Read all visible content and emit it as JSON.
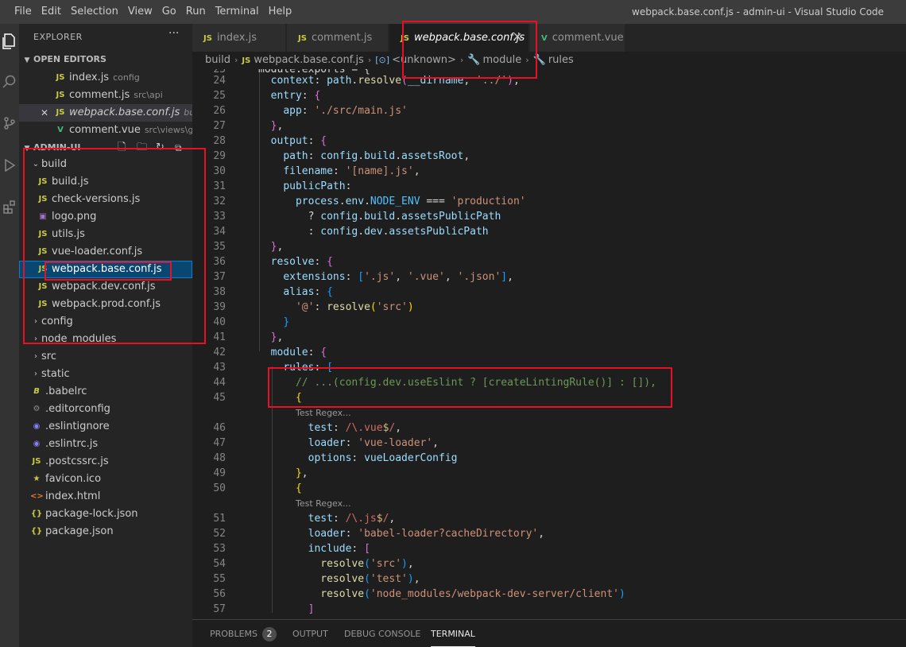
{
  "menu": [
    "File",
    "Edit",
    "Selection",
    "View",
    "Go",
    "Run",
    "Terminal",
    "Help"
  ],
  "window_title": "webpack.base.conf.js - admin-ui - Visual Studio Code",
  "sidebar": {
    "title": "EXPLORER",
    "more": "···",
    "open_editors": {
      "header": "OPEN EDITORS",
      "items": [
        {
          "icon": "JS",
          "name": "index.js",
          "desc": "config"
        },
        {
          "icon": "JS",
          "name": "comment.js",
          "desc": "src\\api"
        },
        {
          "icon": "JS",
          "name": "webpack.base.conf.js",
          "desc": "build"
        },
        {
          "icon": "V",
          "name": "comment.vue",
          "desc": "src\\views\\g..."
        }
      ]
    },
    "project": {
      "header": "ADMIN-UI",
      "tree": [
        {
          "type": "folder",
          "name": "build",
          "open": true
        },
        {
          "type": "file",
          "icon": "JS",
          "name": "build.js"
        },
        {
          "type": "file",
          "icon": "JS",
          "name": "check-versions.js"
        },
        {
          "type": "file",
          "icon": "IMG",
          "name": "logo.png"
        },
        {
          "type": "file",
          "icon": "JS",
          "name": "utils.js"
        },
        {
          "type": "file",
          "icon": "JS",
          "name": "vue-loader.conf.js"
        },
        {
          "type": "file",
          "icon": "JS",
          "name": "webpack.base.conf.js"
        },
        {
          "type": "file",
          "icon": "JS",
          "name": "webpack.dev.conf.js"
        },
        {
          "type": "file",
          "icon": "JS",
          "name": "webpack.prod.conf.js"
        },
        {
          "type": "folder",
          "name": "config"
        },
        {
          "type": "folder",
          "name": "node_modules"
        },
        {
          "type": "folder",
          "name": "src"
        },
        {
          "type": "folder",
          "name": "static"
        },
        {
          "type": "file",
          "icon": "B",
          "name": ".babelrc"
        },
        {
          "type": "file",
          "icon": "⚙",
          "name": ".editorconfig"
        },
        {
          "type": "file",
          "icon": "◉",
          "name": ".eslintignore"
        },
        {
          "type": "file",
          "icon": "◉",
          "name": ".eslintrc.js"
        },
        {
          "type": "file",
          "icon": "JS",
          "name": ".postcssrc.js"
        },
        {
          "type": "file",
          "icon": "★",
          "name": "favicon.ico"
        },
        {
          "type": "file",
          "icon": "<>",
          "name": "index.html"
        },
        {
          "type": "file",
          "icon": "{}",
          "name": "package-lock.json"
        },
        {
          "type": "file",
          "icon": "{}",
          "name": "package.json"
        }
      ]
    }
  },
  "tabs": [
    {
      "icon": "JS",
      "label": "index.js"
    },
    {
      "icon": "JS",
      "label": "comment.js"
    },
    {
      "icon": "JS",
      "label": "webpack.base.conf.js",
      "close": "✕"
    },
    {
      "icon": "V",
      "label": "comment.vue"
    }
  ],
  "breadcrumb": [
    "build",
    "webpack.base.conf.js",
    "<unknown>",
    "module",
    "rules"
  ],
  "editor": {
    "codelens": "Test Regex..."
  },
  "panel": {
    "tabs": [
      "PROBLEMS",
      "OUTPUT",
      "DEBUG CONSOLE",
      "TERMINAL"
    ],
    "problems_count": "2"
  }
}
